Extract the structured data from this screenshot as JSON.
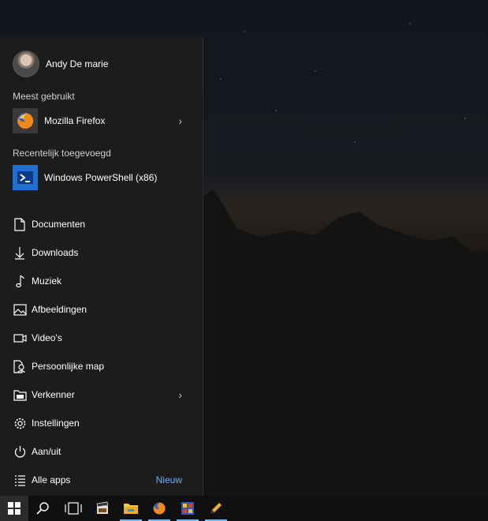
{
  "user": {
    "name": "Andy De marie"
  },
  "most_used": {
    "title": "Meest gebruikt",
    "items": [
      {
        "label": "Mozilla Firefox",
        "icon": "firefox-icon",
        "has_submenu": true
      }
    ]
  },
  "recently_added": {
    "title": "Recentelijk toegevoegd",
    "items": [
      {
        "label": "Windows PowerShell (x86)",
        "icon": "powershell-icon"
      }
    ]
  },
  "places": [
    {
      "label": "Documenten",
      "icon": "document-icon"
    },
    {
      "label": "Downloads",
      "icon": "download-icon"
    },
    {
      "label": "Muziek",
      "icon": "music-icon"
    },
    {
      "label": "Afbeeldingen",
      "icon": "pictures-icon"
    },
    {
      "label": "Video's",
      "icon": "video-icon"
    },
    {
      "label": "Persoonlijke map",
      "icon": "personal-folder-icon"
    },
    {
      "label": "Verkenner",
      "icon": "explorer-icon",
      "has_submenu": true
    },
    {
      "label": "Instellingen",
      "icon": "settings-icon"
    },
    {
      "label": "Aan/uit",
      "icon": "power-icon"
    }
  ],
  "all_apps": {
    "label": "Alle apps",
    "badge": "Nieuw",
    "icon": "list-icon"
  },
  "taskbar": {
    "items": [
      "windows-start-icon",
      "search-icon",
      "task-view-icon",
      "clapperboard-icon",
      "file-explorer-icon",
      "firefox-icon",
      "media-player-icon",
      "pencil-app-icon"
    ]
  },
  "colors": {
    "accent": "#6aaeff",
    "menu_bg": "#1c1c1c",
    "taskbar_bg": "#101010"
  }
}
